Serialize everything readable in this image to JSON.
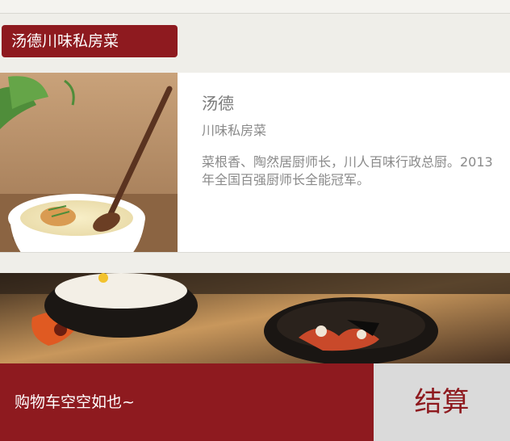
{
  "section": {
    "title": "汤德川味私房菜"
  },
  "chef": {
    "name": "汤德",
    "subtitle": "川味私房菜",
    "description": "菜根香、陶然居厨师长，川人百味行政总厨。2013年全国百强厨师长全能冠军。"
  },
  "cart": {
    "status_text": "购物车空空如也~",
    "checkout_label": "结算"
  },
  "colors": {
    "brand": "#8e1a1f",
    "page_bg": "#efeee9",
    "checkout_bg": "#dadada"
  }
}
